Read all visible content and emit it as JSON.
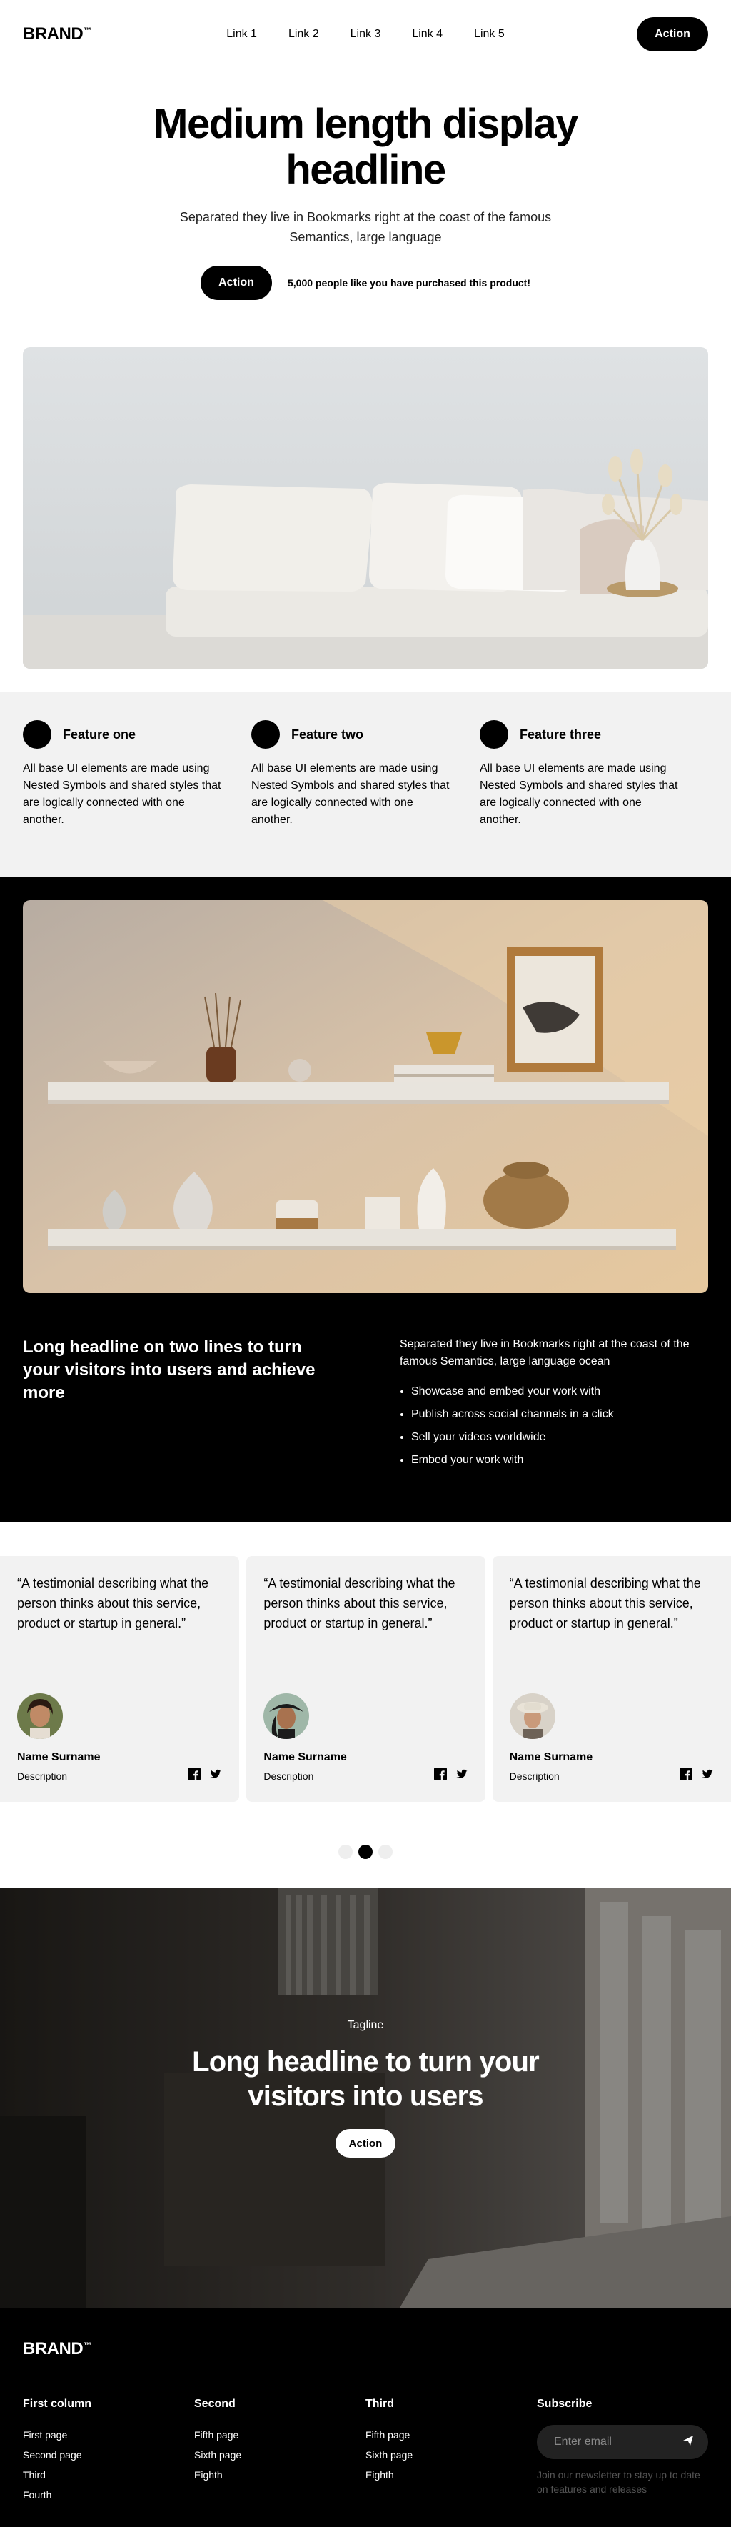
{
  "nav": {
    "brand": "BRAND",
    "brand_mark": "™",
    "links": [
      "Link 1",
      "Link 2",
      "Link 3",
      "Link 4",
      "Link 5"
    ],
    "action": "Action"
  },
  "hero": {
    "headline": "Medium length display headline",
    "subtitle": "Separated they live in Bookmarks right at the coast of the famous Semantics, large language",
    "action": "Action",
    "social_proof": "5,000 people like you have purchased this product!"
  },
  "features": [
    {
      "title": "Feature one",
      "body": "All base UI elements are made using Nested Symbols and shared styles that are logically connected with one another."
    },
    {
      "title": "Feature two",
      "body": "All base UI elements are made using Nested Symbols and shared styles that are logically connected with one another."
    },
    {
      "title": "Feature three",
      "body": "All base UI elements are made using Nested Symbols and shared styles that are logically connected with one another."
    }
  ],
  "dark": {
    "headline": "Long headline on two lines to turn your visitors into users and achieve more",
    "body": "Separated they live in Bookmarks right at the coast of the famous Semantics, large language ocean",
    "bullets": [
      "Showcase and embed your work with",
      "Publish across social channels in a click",
      "Sell your videos worldwide",
      "Embed your work with"
    ]
  },
  "testimonials": [
    {
      "quote": "“A testimonial describing what the person thinks about this service, product or startup in general.”",
      "name": "Name Surname",
      "desc": "Description"
    },
    {
      "quote": "“A testimonial describing what the person thinks about this service, product or startup in general.”",
      "name": "Name Surname",
      "desc": "Description"
    },
    {
      "quote": "“A testimonial describing what the person thinks about this service, product or startup in general.”",
      "name": "Name Surname",
      "desc": "Description"
    }
  ],
  "carousel": {
    "active_index": 1,
    "count": 3
  },
  "banner": {
    "tagline": "Tagline",
    "headline": "Long headline to turn your visitors into users",
    "action": "Action"
  },
  "footer": {
    "brand": "BRAND",
    "brand_mark": "™",
    "columns": [
      {
        "title": "First column",
        "links": [
          "First page",
          "Second page",
          "Third",
          "Fourth"
        ]
      },
      {
        "title": "Second",
        "links": [
          "Fifth page",
          "Sixth page",
          "Eighth"
        ]
      },
      {
        "title": "Third",
        "links": [
          "Fifth page",
          "Sixth page",
          "Eighth"
        ]
      }
    ],
    "subscribe": {
      "title": "Subscribe",
      "placeholder": "Enter email",
      "note": "Join our newsletter to stay up to date on features and releases"
    }
  }
}
